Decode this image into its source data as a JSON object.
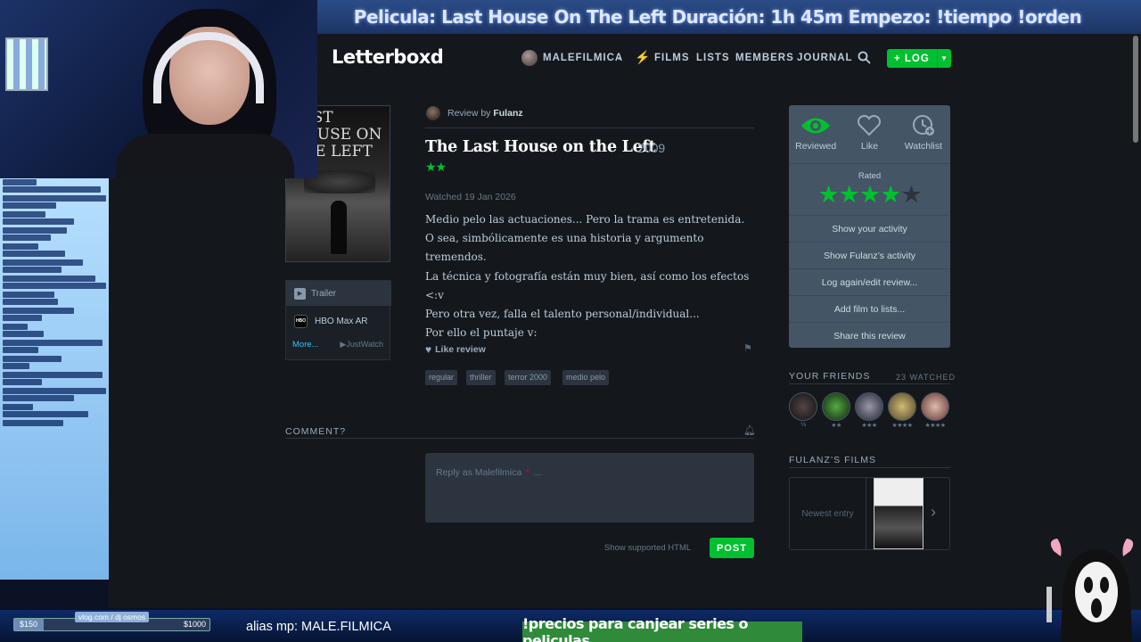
{
  "overlay": {
    "banner": "Pelicula: Last House On The Left  Duración: 1h 45m Empezo: !tiempo !orden",
    "alias": "alias mp: MALE.FILMICA",
    "precios": "!precios para canjear series o peliculas",
    "goal_label": "vlog.com / dj osmos",
    "goal_min": "$150",
    "goal_max": "$1000",
    "goal_progress": 0.15
  },
  "nav": {
    "logo": "Letterboxd",
    "user": "MALEFILMICA",
    "films": "FILMS",
    "lists": "LISTS",
    "members": "MEMBERS",
    "journal": "JOURNAL",
    "log": "+ LOG"
  },
  "watch": {
    "trailer": "Trailer",
    "service": "HBO Max AR",
    "service_icon": "HBO",
    "more": "More...",
    "justwatch": "JustWatch"
  },
  "poster": {
    "text": "LAST HOUSE ON THE LEFT"
  },
  "review": {
    "by_prefix": "Review by",
    "author": "Fulanz",
    "title": "The Last House on the Left",
    "year": "2009",
    "stars": "★★",
    "watched": "Watched 19 Jan 2026",
    "text": [
      "Medio pelo las actuaciones... Pero la trama es entretenida.",
      "O sea, simbólicamente es una historia y argumento",
      "tremendos.",
      "La técnica y fotografía están muy bien, así como los efectos <:v",
      "Pero otra vez, falla el talento personal/individual...",
      "Por ello el puntaje v:"
    ],
    "like": "Like review",
    "tags": [
      "regular",
      "thriller",
      "terror 2000",
      "medio pelo"
    ]
  },
  "comment": {
    "heading": "COMMENT?",
    "placeholder": "Reply as Malefilmica",
    "required": "*",
    "placeholder_suffix": "...",
    "html": "Show supported HTML",
    "post": "POST"
  },
  "sidebar": {
    "reviewed": "Reviewed",
    "like": "Like",
    "watchlist": "Watchlist",
    "rated": "Rated",
    "rating": 4,
    "rating_max": 5,
    "rows": [
      "Show your activity",
      "Show Fulanz’s activity",
      "Log again/edit review...",
      "Add film to lists...",
      "Share this review"
    ],
    "friends_heading": "YOUR FRIENDS",
    "friends_count": "23 WATCHED",
    "friend_ratings": [
      "½",
      "★★",
      "★★★",
      "★★★★",
      "★★★★"
    ],
    "films_heading": "FULANZ’S FILMS",
    "newest": "Newest entry"
  },
  "colors": {
    "accent_green": "#00c030",
    "link_blue": "#40bcf4",
    "background": "#14181c",
    "panel": "#445566"
  }
}
